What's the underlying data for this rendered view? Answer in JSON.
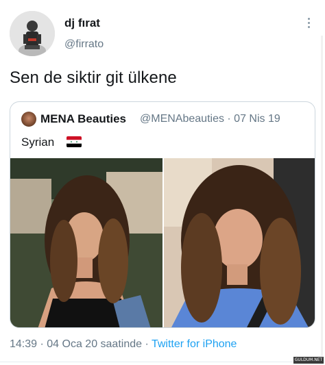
{
  "tweet": {
    "author": {
      "display_name": "dj fırat",
      "handle": "@firrato",
      "avatar_icon": "profile-avatar"
    },
    "more_icon": "more-vertical-icon",
    "text": "Sen de siktir git ülkene",
    "timestamp": "14:39 · 04 Oca 20 saatinde · ",
    "client": "Twitter for iPhone"
  },
  "quoted_tweet": {
    "display_name": "MENA Beauties",
    "meta": "@MENAbeauties · 07 Nis 19",
    "text": "Syrian",
    "flag_icon": "syria-flag-icon",
    "media": [
      "photo-left",
      "photo-right"
    ]
  },
  "colors": {
    "accent": "#1da1f2",
    "secondary_text": "#657786",
    "border": "#ccd6dd"
  },
  "watermark": "GULDUM.NET"
}
